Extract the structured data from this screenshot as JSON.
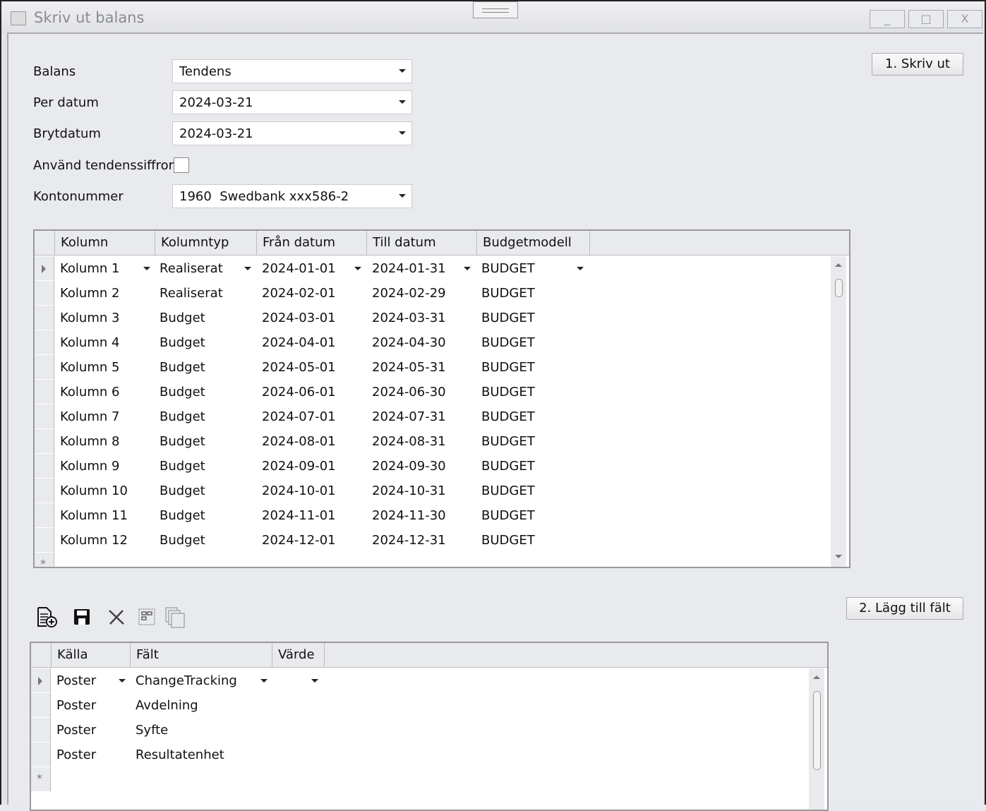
{
  "window": {
    "title": "Skriv ut balans",
    "minimize": "_",
    "maximize": "□",
    "close": "X"
  },
  "form": {
    "balans_label": "Balans",
    "balans_value": "Tendens",
    "per_datum_label": "Per datum",
    "per_datum_value": "2024-03-21",
    "brytdatum_label": "Brytdatum",
    "brytdatum_value": "2024-03-21",
    "tendens_label": "Använd tendenssiffror",
    "tendens_checked": false,
    "konto_label": "Kontonummer",
    "konto_value": "1960  Swedbank xxx586-2"
  },
  "buttons": {
    "print": "1. Skriv ut",
    "add_field": "2. Lägg till fält"
  },
  "columns_grid": {
    "headers": [
      "Kolumn",
      "Kolumntyp",
      "Från datum",
      "Till datum",
      "Budgetmodell"
    ],
    "rows": [
      [
        "Kolumn 1",
        "Realiserat",
        "2024-01-01",
        "2024-01-31",
        "BUDGET"
      ],
      [
        "Kolumn 2",
        "Realiserat",
        "2024-02-01",
        "2024-02-29",
        "BUDGET"
      ],
      [
        "Kolumn 3",
        "Budget",
        "2024-03-01",
        "2024-03-31",
        "BUDGET"
      ],
      [
        "Kolumn 4",
        "Budget",
        "2024-04-01",
        "2024-04-30",
        "BUDGET"
      ],
      [
        "Kolumn 5",
        "Budget",
        "2024-05-01",
        "2024-05-31",
        "BUDGET"
      ],
      [
        "Kolumn 6",
        "Budget",
        "2024-06-01",
        "2024-06-30",
        "BUDGET"
      ],
      [
        "Kolumn 7",
        "Budget",
        "2024-07-01",
        "2024-07-31",
        "BUDGET"
      ],
      [
        "Kolumn 8",
        "Budget",
        "2024-08-01",
        "2024-08-31",
        "BUDGET"
      ],
      [
        "Kolumn 9",
        "Budget",
        "2024-09-01",
        "2024-09-30",
        "BUDGET"
      ],
      [
        "Kolumn 10",
        "Budget",
        "2024-10-01",
        "2024-10-31",
        "BUDGET"
      ],
      [
        "Kolumn 11",
        "Budget",
        "2024-11-01",
        "2024-11-30",
        "BUDGET"
      ],
      [
        "Kolumn 12",
        "Budget",
        "2024-12-01",
        "2024-12-31",
        "BUDGET"
      ]
    ]
  },
  "toolbar": [
    "new-document-icon",
    "save-icon",
    "delete-icon",
    "select-icon",
    "copy-icon"
  ],
  "fields_grid": {
    "headers": [
      "Källa",
      "Fält",
      "Värde"
    ],
    "rows": [
      [
        "Poster",
        "ChangeTracking",
        ""
      ],
      [
        "Poster",
        "Avdelning",
        ""
      ],
      [
        "Poster",
        "Syfte",
        ""
      ],
      [
        "Poster",
        "Resultatenhet",
        ""
      ]
    ]
  },
  "new_row_marker": "*"
}
